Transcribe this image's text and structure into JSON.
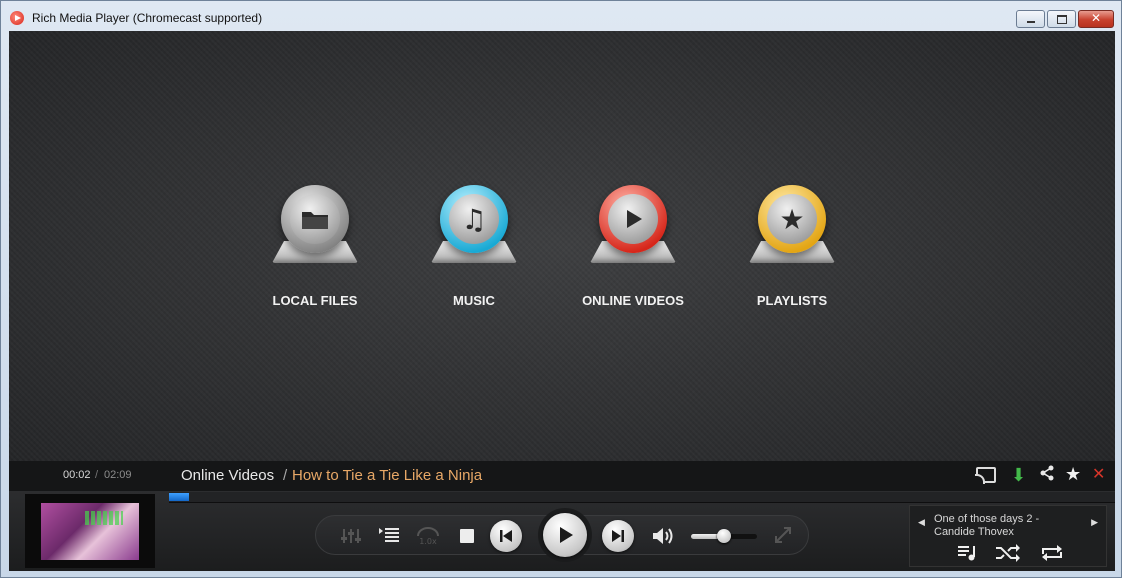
{
  "window": {
    "title": "Rich Media Player (Chromecast supported)"
  },
  "home_menu": {
    "items": [
      {
        "label": "LOCAL FILES",
        "icon": "folder-icon",
        "color": "#8a8a8a"
      },
      {
        "label": "MUSIC",
        "icon": "music-note-icon",
        "color": "#19a9d4"
      },
      {
        "label": "ONLINE VIDEOS",
        "icon": "play-icon",
        "color": "#d6261a"
      },
      {
        "label": "PLAYLISTS",
        "icon": "star-icon",
        "color": "#e3a514"
      }
    ]
  },
  "infobar": {
    "time_current": "00:02",
    "time_separator": "/",
    "time_total": "02:09",
    "breadcrumb_parent": "Online Videos",
    "breadcrumb_separator": "/",
    "breadcrumb_current": "How to Tie a Tie Like a Ninja"
  },
  "playback": {
    "progress_fraction": 0.02,
    "volume_fraction": 0.5,
    "speed_label": "1.0x",
    "accent_color": "#2a86f0"
  },
  "now_playing": {
    "line1": "One of those days 2 -",
    "line2": "Candide Thovex"
  },
  "icons": {
    "minimize": "◻",
    "close": "✕",
    "folder": "🗀",
    "music": "♫",
    "play": "▶",
    "star": "★",
    "cast": "cast-icon",
    "download": "⬇",
    "share": "share-icon",
    "favorite": "★",
    "remove": "✕",
    "equalizer": "┇┇┇",
    "playlist": "☰",
    "stop": "■",
    "prev": "⏮",
    "next": "⏭",
    "volume": "🔊",
    "fullscreen": "⤢",
    "queue": "☰",
    "shuffle": "⤮",
    "repeat": "⟲"
  }
}
